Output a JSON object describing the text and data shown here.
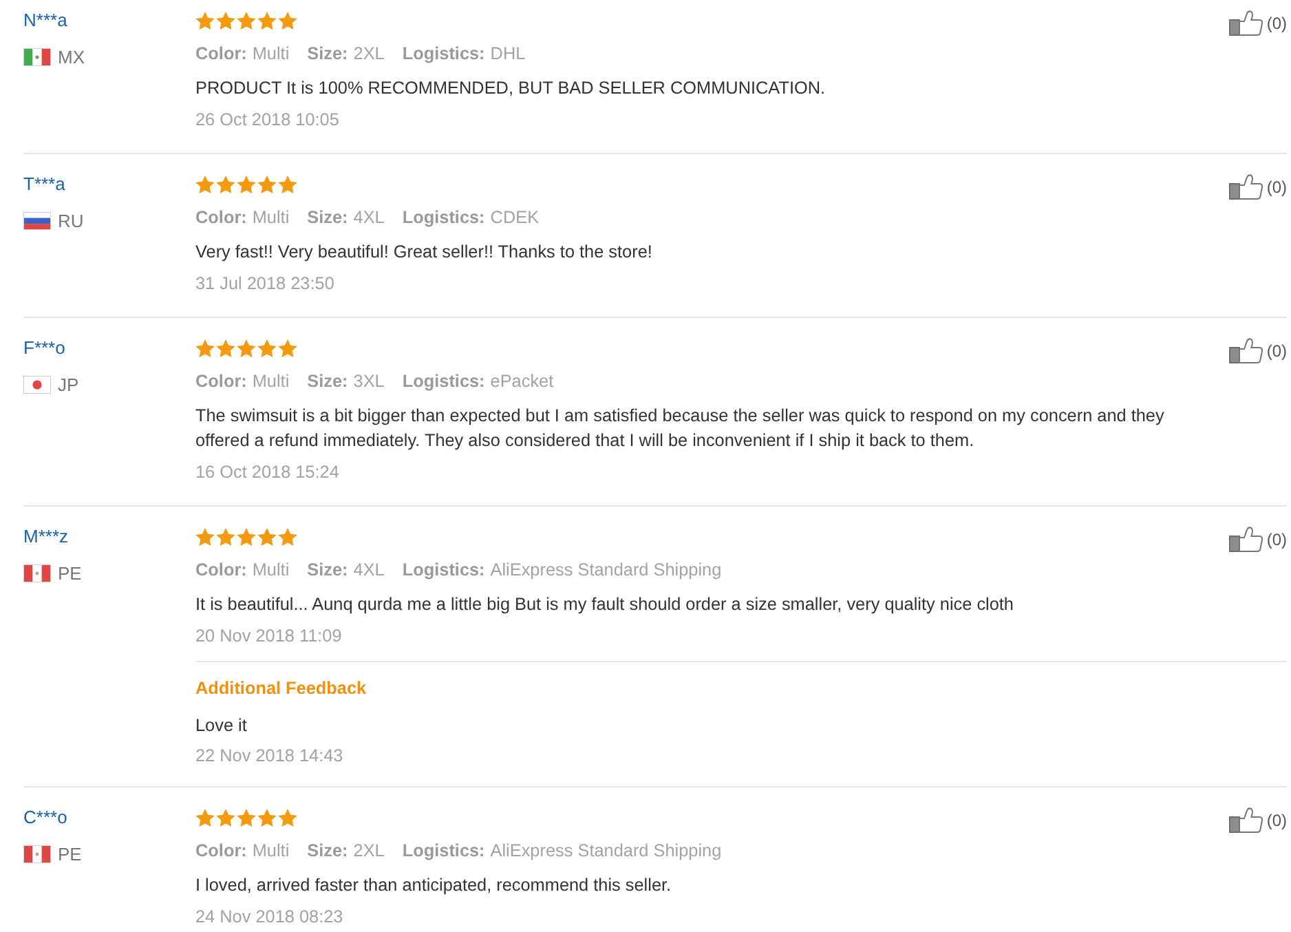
{
  "reviews": [
    {
      "reviewer": "N***a",
      "country": "MX",
      "flag": {
        "kind": "mexico"
      },
      "stars": 5,
      "attributes": [
        {
          "label": "Color:",
          "value": "Multi"
        },
        {
          "label": "Size:",
          "value": "2XL"
        },
        {
          "label": "Logistics:",
          "value": "DHL"
        }
      ],
      "text": "PRODUCT It is 100% RECOMMENDED, BUT BAD SELLER COMMUNICATION.",
      "date": "26 Oct 2018 10:05",
      "likes": "(0)"
    },
    {
      "reviewer": "T***a",
      "country": "RU",
      "flag": {
        "kind": "russia"
      },
      "stars": 5,
      "attributes": [
        {
          "label": "Color:",
          "value": "Multi"
        },
        {
          "label": "Size:",
          "value": "4XL"
        },
        {
          "label": "Logistics:",
          "value": "CDEK"
        }
      ],
      "text": "Very fast!! Very beautiful! Great seller!! Thanks to the store!",
      "date": "31 Jul 2018 23:50",
      "likes": "(0)"
    },
    {
      "reviewer": "F***o",
      "country": "JP",
      "flag": {
        "kind": "japan"
      },
      "stars": 5,
      "attributes": [
        {
          "label": "Color:",
          "value": "Multi"
        },
        {
          "label": "Size:",
          "value": "3XL"
        },
        {
          "label": "Logistics:",
          "value": "ePacket"
        }
      ],
      "text": "The swimsuit is a bit bigger than expected but I am satisfied because the seller was quick to respond on my concern and they offered a refund immediately. They also considered that I will be inconvenient if I ship it back to them.",
      "date": "16 Oct 2018 15:24",
      "likes": "(0)"
    },
    {
      "reviewer": "M***z",
      "country": "PE",
      "flag": {
        "kind": "peru"
      },
      "stars": 5,
      "attributes": [
        {
          "label": "Color:",
          "value": "Multi"
        },
        {
          "label": "Size:",
          "value": "4XL"
        },
        {
          "label": "Logistics:",
          "value": "AliExpress Standard Shipping"
        }
      ],
      "text": "It is beautiful... Aunq qurda me a little big But is my fault should order a size smaller, very quality nice cloth",
      "date": "20 Nov 2018 11:09",
      "likes": "(0)",
      "additional_feedback": {
        "title": "Additional Feedback",
        "text": "Love it",
        "date": "22 Nov 2018 14:43"
      }
    },
    {
      "reviewer": "C***o",
      "country": "PE",
      "flag": {
        "kind": "peru"
      },
      "stars": 5,
      "attributes": [
        {
          "label": "Color:",
          "value": "Multi"
        },
        {
          "label": "Size:",
          "value": "2XL"
        },
        {
          "label": "Logistics:",
          "value": "AliExpress Standard Shipping"
        }
      ],
      "text": "I loved, arrived faster than anticipated, recommend this seller.",
      "date": "24 Nov 2018 08:23",
      "likes": "(0)"
    }
  ]
}
